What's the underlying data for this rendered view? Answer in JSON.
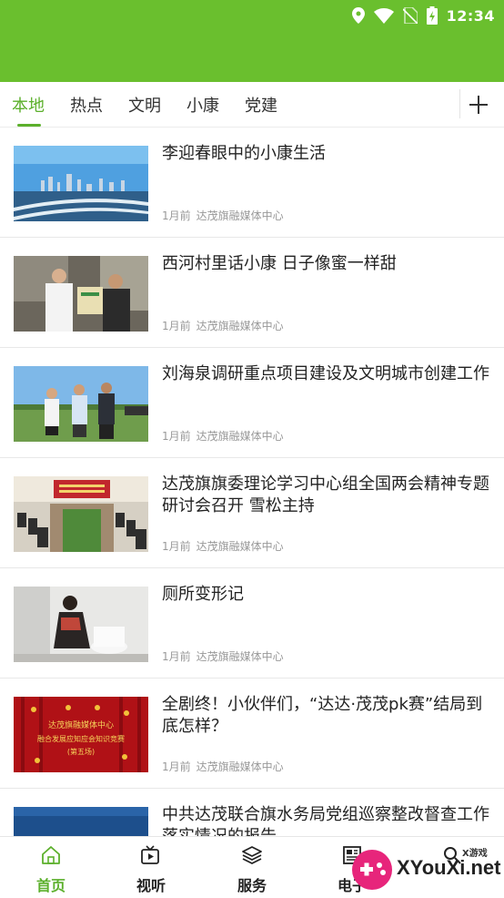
{
  "status_bar": {
    "time": "12:34",
    "icons": [
      "location-icon",
      "wifi-icon",
      "no-sim-icon",
      "battery-charging-icon"
    ]
  },
  "tabs": [
    {
      "label": "本地",
      "active": true
    },
    {
      "label": "热点",
      "active": false
    },
    {
      "label": "文明",
      "active": false
    },
    {
      "label": "小康",
      "active": false
    },
    {
      "label": "党建",
      "active": false
    }
  ],
  "colors": {
    "brand_green": "#6abf2e",
    "accent_green": "#5cb02c"
  },
  "news": [
    {
      "title": "李迎春眼中的小康生活",
      "time": "1月前",
      "source": "达茂旗融媒体中心"
    },
    {
      "title": "西河村里话小康  日子像蜜一样甜",
      "time": "1月前",
      "source": "达茂旗融媒体中心"
    },
    {
      "title": "刘海泉调研重点项目建设及文明城市创建工作",
      "time": "1月前",
      "source": "达茂旗融媒体中心"
    },
    {
      "title": "达茂旗旗委理论学习中心组全国两会精神专题研讨会召开  雪松主持",
      "time": "1月前",
      "source": "达茂旗融媒体中心"
    },
    {
      "title": "厕所变形记",
      "time": "1月前",
      "source": "达茂旗融媒体中心"
    },
    {
      "title": "全剧终！小伙伴们，“达达·茂茂pk赛”结局到底怎样？",
      "time": "1月前",
      "source": "达茂旗融媒体中心"
    },
    {
      "title": "中共达茂联合旗水务局党组巡察整改督查工作落实情况的报告",
      "time": "",
      "source": ""
    }
  ],
  "thumb_texts": {
    "banner_line1": "达茂旗融媒体中心",
    "banner_line2": "融合发展应知应会知识竞赛",
    "banner_line3": "(第五场)"
  },
  "bottom_nav": [
    {
      "label": "首页",
      "icon": "home-icon",
      "active": true
    },
    {
      "label": "视听",
      "icon": "video-icon",
      "active": false
    },
    {
      "label": "服务",
      "icon": "layers-icon",
      "active": false
    },
    {
      "label": "电子",
      "icon": "newspaper-icon",
      "active": false
    },
    {
      "label": "",
      "icon": "search-icon",
      "active": false
    }
  ],
  "watermark": {
    "text": "XYouXi.net",
    "sub": "X游戏"
  }
}
